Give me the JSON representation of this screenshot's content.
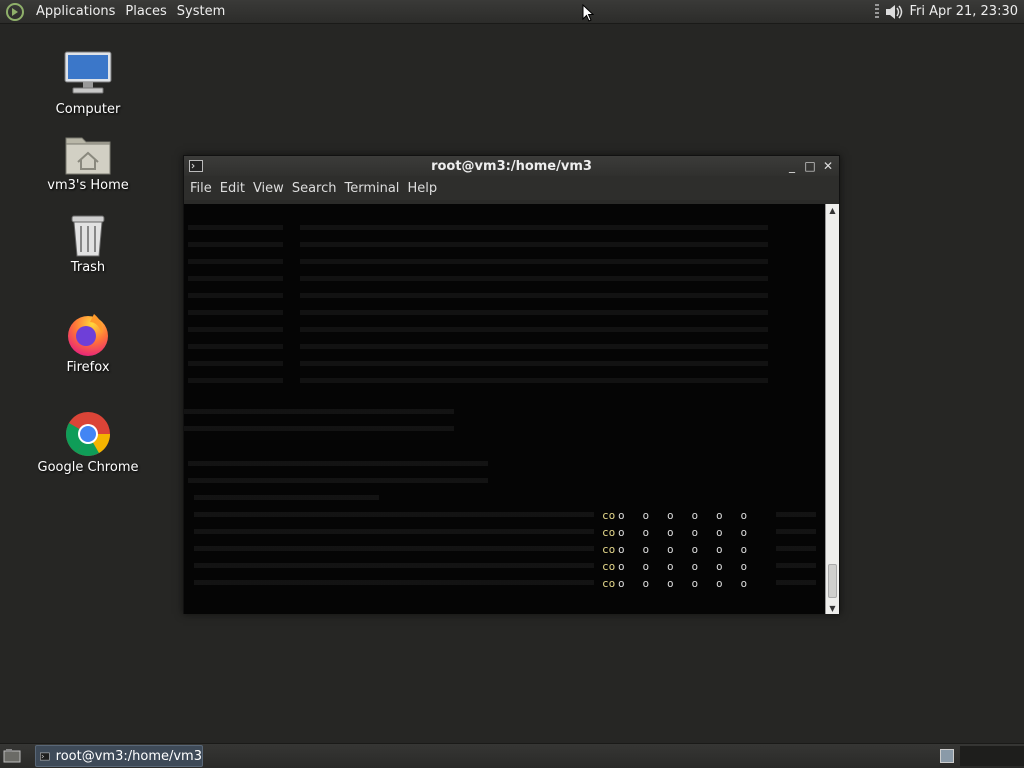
{
  "top_panel": {
    "menus": [
      "Applications",
      "Places",
      "System"
    ],
    "clock": "Fri Apr 21, 23:30"
  },
  "desktop_icons": [
    {
      "label": "Computer",
      "icon": "computer-icon"
    },
    {
      "label": "vm3's Home",
      "icon": "home-folder-icon"
    },
    {
      "label": "Trash",
      "icon": "trash-icon"
    },
    {
      "label": "Firefox",
      "icon": "firefox-icon"
    },
    {
      "label": "Google Chrome",
      "icon": "chrome-icon"
    }
  ],
  "window": {
    "title": "root@vm3:/home/vm3",
    "menu": [
      "File",
      "Edit",
      "View",
      "Search",
      "Terminal",
      "Help"
    ],
    "controls": {
      "minimize": "_",
      "maximize": "□",
      "close": "✕"
    }
  },
  "taskbar": {
    "task_label": "root@vm3:/home/vm3"
  },
  "colors": {
    "desktop_bg": "#262624",
    "terminal_bg": "#050505",
    "progress_dot_highlight": "#e6d98c"
  }
}
